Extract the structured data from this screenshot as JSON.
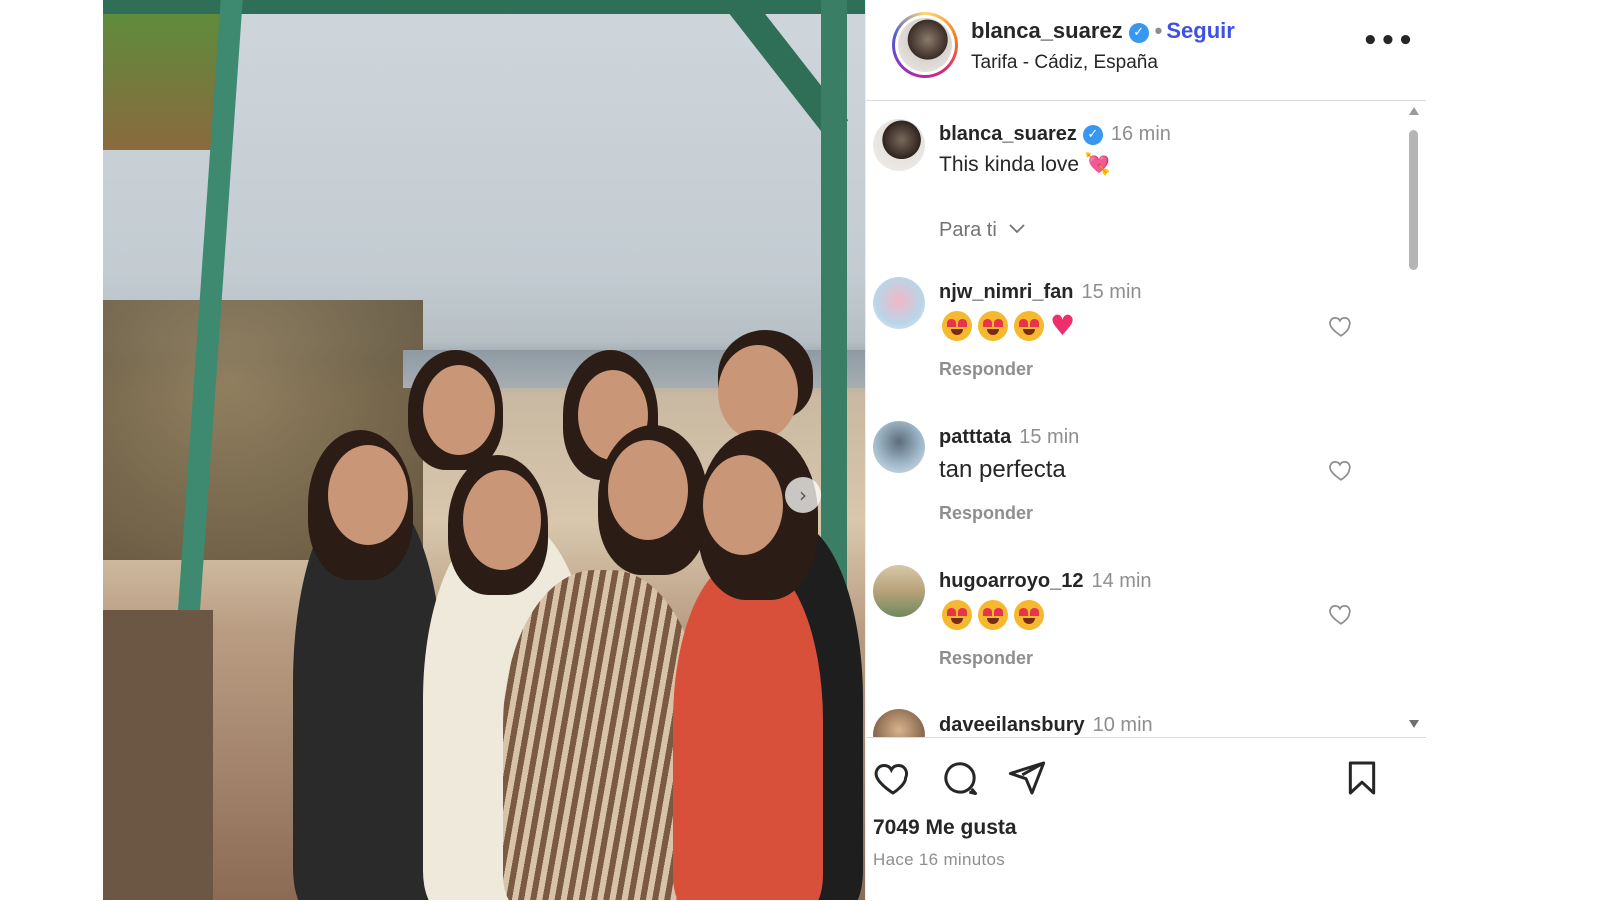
{
  "post": {
    "author": "blanca_suarez",
    "follow_label": "Seguir",
    "location": "Tarifa - Cádiz, España",
    "more_label": "•••",
    "verified_mark": "✓"
  },
  "caption": {
    "user": "blanca_suarez",
    "time": "16 min",
    "text": "This kinda love 💘"
  },
  "filter": {
    "label": "Para ti"
  },
  "comments": [
    {
      "user": "njw_nimri_fan",
      "time": "15 min",
      "text": "",
      "emojis": [
        "heart-eyes",
        "heart-eyes",
        "heart-eyes",
        "red-heart"
      ],
      "reply": "Responder"
    },
    {
      "user": "patttata",
      "time": "15 min",
      "text": "tan perfecta",
      "emojis": [],
      "reply": "Responder"
    },
    {
      "user": "hugoarroyo_12",
      "time": "14 min",
      "text": "",
      "emojis": [
        "heart-eyes",
        "heart-eyes",
        "heart-eyes"
      ],
      "reply": "Responder"
    },
    {
      "user": "daveeilansbury",
      "time": "10 min",
      "text": "",
      "emojis": [],
      "reply": ""
    }
  ],
  "footer": {
    "likes": "7049 Me gusta",
    "time_ago": "Hace 16 minutos"
  },
  "carousel": {
    "next_label": "›"
  },
  "colors": {
    "accent": "#3f51e0",
    "verified": "#3897f0",
    "muted": "#8e8e8e",
    "text": "#262626"
  }
}
